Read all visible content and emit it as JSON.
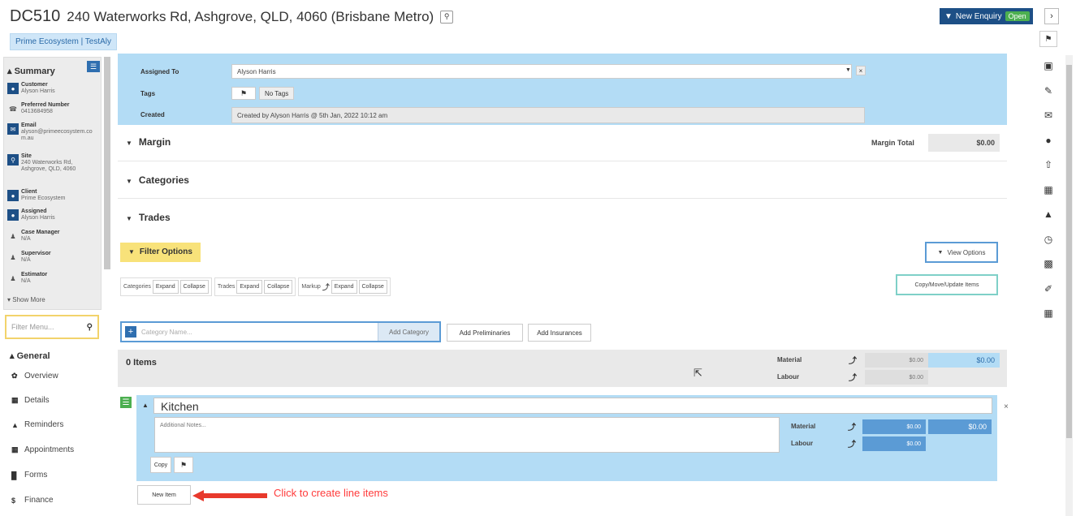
{
  "header": {
    "job_code": "DC510",
    "address": "240 Waterworks Rd, Ashgrove, QLD, 4060 (Brisbane Metro)",
    "ecosystem": "Prime Ecosystem | TestAly",
    "enquiry_label": "New Enquiry",
    "status_badge": "Open"
  },
  "summary": {
    "title": "Summary",
    "items": [
      {
        "label": "Customer",
        "value": "Alyson Harris",
        "icon": "user-icon"
      },
      {
        "label": "Preferred Number",
        "value": "0413684958",
        "icon": "phone-icon"
      },
      {
        "label": "Email",
        "value": "alyson@primeecosystem.com.au",
        "icon": "email-icon"
      },
      {
        "label": "Site",
        "value": "240 Waterworks Rd, Ashgrove, QLD, 4060",
        "icon": "map-pin-icon"
      },
      {
        "label": "Client",
        "value": "Prime Ecosystem",
        "icon": "user-icon"
      },
      {
        "label": "Assigned",
        "value": "Alyson Harris",
        "icon": "user-icon"
      },
      {
        "label": "Case Manager",
        "value": "N/A",
        "icon": "person-icon"
      },
      {
        "label": "Supervisor",
        "value": "N/A",
        "icon": "person-icon"
      },
      {
        "label": "Estimator",
        "value": "N/A",
        "icon": "person-icon"
      }
    ],
    "show_more": "Show More"
  },
  "filter_menu_placeholder": "Filter Menu...",
  "nav": {
    "general_title": "General",
    "items": [
      {
        "label": "Overview",
        "icon": "overview-icon"
      },
      {
        "label": "Details",
        "icon": "details-icon"
      },
      {
        "label": "Reminders",
        "icon": "bell-icon"
      },
      {
        "label": "Appointments",
        "icon": "calendar-icon"
      },
      {
        "label": "Forms",
        "icon": "forms-icon"
      },
      {
        "label": "Finance",
        "icon": "dollar-icon"
      }
    ]
  },
  "details": {
    "assigned_to_label": "Assigned To",
    "assigned_to_value": "Alyson Harris",
    "tags_label": "Tags",
    "tags_value": "No Tags",
    "created_label": "Created",
    "created_value": "Created by Alyson Harris @ 5th Jan, 2022 10:12 am"
  },
  "sections": {
    "margin": "Margin",
    "categories": "Categories",
    "trades": "Trades",
    "margin_total_label": "Margin Total",
    "margin_total_value": "$0.00"
  },
  "filter_options": {
    "label": "Filter Options",
    "view_options": "View Options",
    "copy_move": "Copy/Move/Update Items",
    "toolbar": {
      "categories": "Categories",
      "trades": "Trades",
      "markup": "Markup",
      "expand": "Expand",
      "collapse": "Collapse"
    }
  },
  "add_bar": {
    "placeholder": "Category Name...",
    "add_category": "Add Category",
    "add_preliminaries": "Add Preliminaries",
    "add_insurances": "Add Insurances"
  },
  "items": {
    "title": "0 Items",
    "material_label": "Material",
    "labour_label": "Labour",
    "material_value": "$0.00",
    "labour_value": "$0.00",
    "total_value": "$0.00"
  },
  "kitchen": {
    "name": "Kitchen",
    "notes_placeholder": "Additional Notes...",
    "material_label": "Material",
    "labour_label": "Labour",
    "material_value": "$0.00",
    "labour_value": "$0.00",
    "total_value": "$0.00",
    "copy_label": "Copy"
  },
  "new_item": {
    "label": "New Item",
    "annotation": "Click to create line items"
  },
  "right_icons": [
    "note-icon",
    "edit-icon",
    "mail-icon",
    "chat-icon",
    "upload-icon",
    "contact-icon",
    "bell-icon",
    "clock-icon",
    "image-icon",
    "brush-icon",
    "calculator-icon"
  ],
  "colors": {
    "primary": "#1d4f86",
    "light_blue": "#b3dcf5",
    "open_green": "#4caf50",
    "filter_yellow": "#f8e27a",
    "annotation_red": "#ff3b3b"
  }
}
